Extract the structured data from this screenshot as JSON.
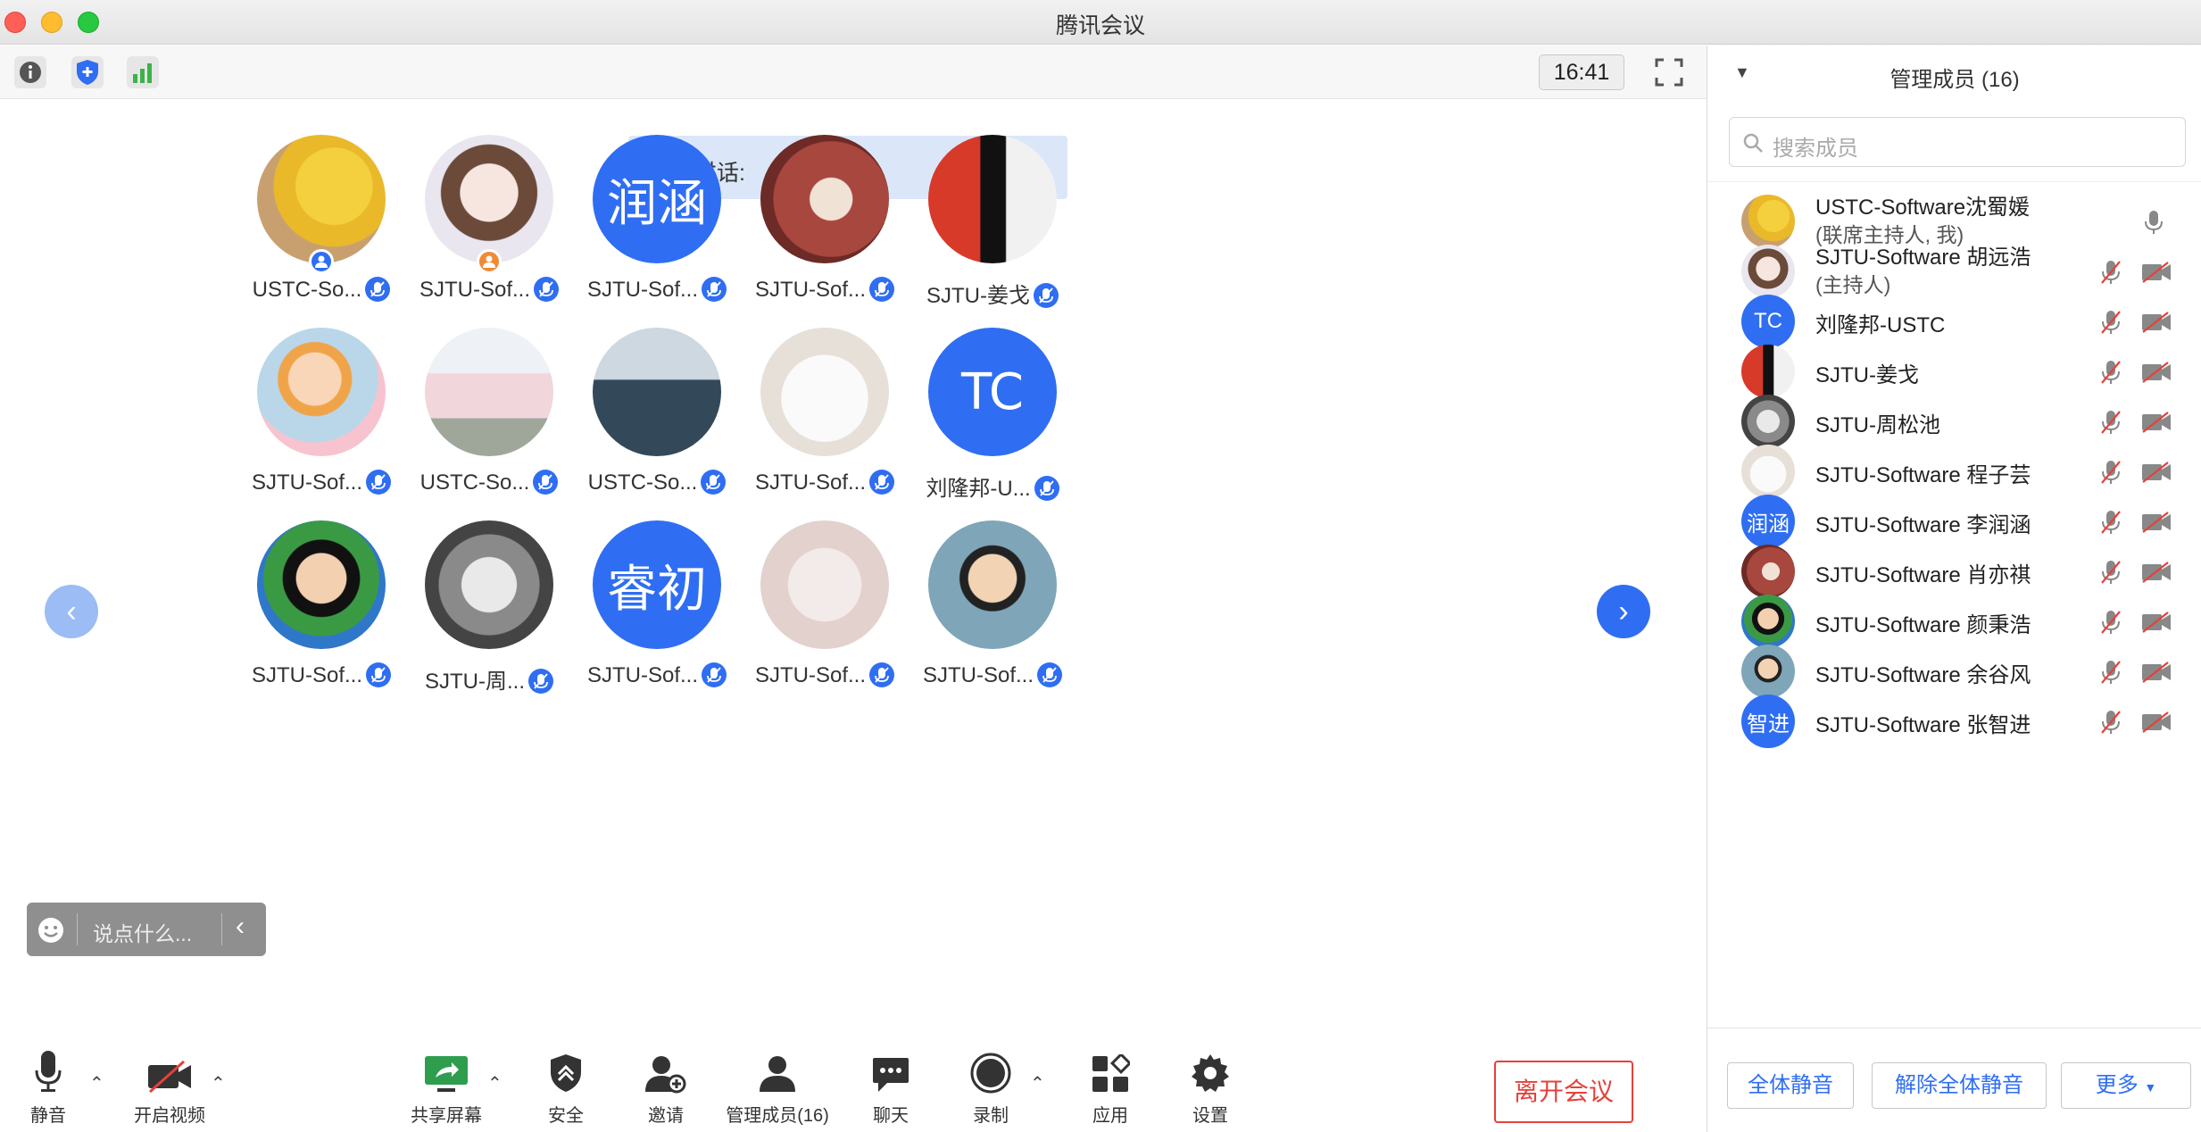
{
  "window": {
    "title": "腾讯会议"
  },
  "top_toolbar": {
    "time": "16:41"
  },
  "speaking": {
    "label": "正在讲话:"
  },
  "grid": {
    "tiles": [
      {
        "name": "USTC-So...",
        "avatar_text": "",
        "avatar_style": "photo-pikachu",
        "host_badge": "cohost"
      },
      {
        "name": "SJTU-Sof...",
        "avatar_text": "",
        "avatar_style": "anime-girl",
        "host_badge": "host"
      },
      {
        "name": "SJTU-Sof...",
        "avatar_text": "润涵",
        "avatar_style": "text"
      },
      {
        "name": "SJTU-Sof...",
        "avatar_text": "",
        "avatar_style": "red-illustration"
      },
      {
        "name": "SJTU-姜戈",
        "avatar_text": "",
        "avatar_style": "red-bw"
      },
      {
        "name": "SJTU-Sof...",
        "avatar_text": "",
        "avatar_style": "cartoon-girl"
      },
      {
        "name": "USTC-So...",
        "avatar_text": "",
        "avatar_style": "sakura"
      },
      {
        "name": "USTC-So...",
        "avatar_text": "",
        "avatar_style": "forest"
      },
      {
        "name": "SJTU-Sof...",
        "avatar_text": "",
        "avatar_style": "eevee"
      },
      {
        "name": "刘隆邦-U...",
        "avatar_text": "TC",
        "avatar_style": "text"
      },
      {
        "name": "SJTU-Sof...",
        "avatar_text": "",
        "avatar_style": "boy"
      },
      {
        "name": "SJTU-周...",
        "avatar_text": "",
        "avatar_style": "grey-anime"
      },
      {
        "name": "SJTU-Sof...",
        "avatar_text": "睿初",
        "avatar_style": "text"
      },
      {
        "name": "SJTU-Sof...",
        "avatar_text": "",
        "avatar_style": "hands"
      },
      {
        "name": "SJTU-Sof...",
        "avatar_text": "",
        "avatar_style": "glasses-man"
      }
    ]
  },
  "chat": {
    "placeholder": "说点什么..."
  },
  "bottom_toolbar": {
    "mute": "静音",
    "video": "开启视频",
    "share": "共享屏幕",
    "security": "安全",
    "invite": "邀请",
    "members": "管理成员(16)",
    "chat": "聊天",
    "record": "录制",
    "apps": "应用",
    "settings": "设置",
    "leave": "离开会议"
  },
  "panel": {
    "title": "管理成员 (16)",
    "search_placeholder": "搜索成员",
    "members": [
      {
        "name": "USTC-Software沈蜀媛",
        "sub": "(联席主持人, 我)",
        "avatar_text": "",
        "avatar_style": "photo-pikachu",
        "muted": false
      },
      {
        "name": "SJTU-Software 胡远浩",
        "sub": "(主持人)",
        "avatar_text": "",
        "avatar_style": "anime-girl",
        "muted": true
      },
      {
        "name": "刘隆邦-USTC",
        "sub": "",
        "avatar_text": "TC",
        "avatar_style": "text",
        "muted": true
      },
      {
        "name": "SJTU-姜戈",
        "sub": "",
        "avatar_text": "",
        "avatar_style": "red-bw",
        "muted": true
      },
      {
        "name": "SJTU-周松池",
        "sub": "",
        "avatar_text": "",
        "avatar_style": "grey-anime",
        "muted": true
      },
      {
        "name": "SJTU-Software 程子芸",
        "sub": "",
        "avatar_text": "",
        "avatar_style": "eevee",
        "muted": true
      },
      {
        "name": "SJTU-Software 李润涵",
        "sub": "",
        "avatar_text": "润涵",
        "avatar_style": "text",
        "muted": true
      },
      {
        "name": "SJTU-Software 肖亦祺",
        "sub": "",
        "avatar_text": "",
        "avatar_style": "red-illustration",
        "muted": true
      },
      {
        "name": "SJTU-Software 颜秉浩",
        "sub": "",
        "avatar_text": "",
        "avatar_style": "boy",
        "muted": true
      },
      {
        "name": "SJTU-Software 余谷风",
        "sub": "",
        "avatar_text": "",
        "avatar_style": "glasses-man",
        "muted": true
      },
      {
        "name": "SJTU-Software 张智进",
        "sub": "",
        "avatar_text": "智进",
        "avatar_style": "text",
        "muted": true
      }
    ],
    "footer": {
      "mute_all": "全体静音",
      "unmute_all": "解除全体静音",
      "more": "更多"
    }
  },
  "colors": {
    "accent": "#2f6ef3",
    "leave": "#e5413a",
    "shield": "#2f6ef3",
    "signal": "#3db24b"
  }
}
